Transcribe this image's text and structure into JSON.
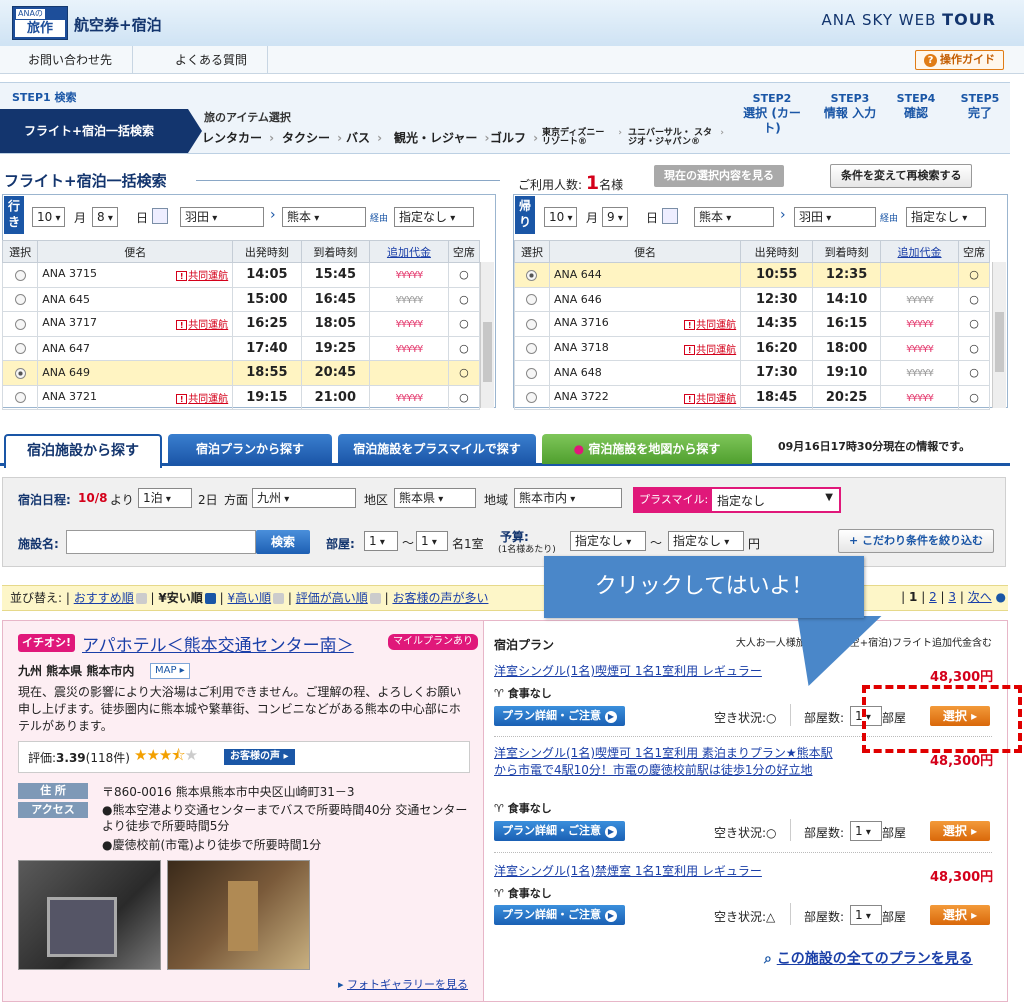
{
  "header": {
    "logo_top": "ANAの",
    "logo_main": "旅作",
    "title": "航空券+宿泊",
    "brand_prefix": "ANA SKY WEB",
    "brand_suffix": "TOUR"
  },
  "nav": {
    "items": [
      "お問い合わせ先",
      "よくある質問"
    ],
    "guide": "操作ガイド",
    "guide_icon": "?"
  },
  "steps": {
    "step1_label": "STEP1 検索",
    "step1_box": "フライト+宿泊一括検索",
    "items_heading": "旅のアイテム選択",
    "item_tabs": [
      "レンタカー",
      "タクシー",
      "バス",
      "観光・レジャー",
      "ゴルフ",
      "東京ディズニー リゾート®",
      "ユニバーサル・ スタジオ・ジャパン®"
    ],
    "later_steps": [
      {
        "num": "STEP2",
        "label": "選択 (カート)"
      },
      {
        "num": "STEP3",
        "label": "情報 入力"
      },
      {
        "num": "STEP4",
        "label": "確認"
      },
      {
        "num": "STEP5",
        "label": "完了"
      }
    ]
  },
  "search": {
    "heading": "フライト+宿泊一括検索",
    "pax_label": "ご利用人数:",
    "pax_count": "1",
    "pax_unit": "名様",
    "view_current": "現在の選択内容を見る",
    "re_search": "条件を変えて再検索する"
  },
  "outbound": {
    "dir": "行き",
    "month": "10",
    "month_unit": "月",
    "day": "8",
    "day_unit": "日",
    "from": "羽田",
    "to": "熊本",
    "via_label": "経由",
    "via": "指定なし",
    "headers": [
      "選択",
      "便名",
      "出発時刻",
      "到着時刻",
      "追加代金",
      "空席"
    ],
    "rows": [
      {
        "selected": false,
        "flight": "ANA 3715",
        "codeshare": true,
        "dep": "14:05",
        "arr": "15:45",
        "price": "¥¥¥¥¥",
        "grey": false,
        "seat": "○",
        "hl": false
      },
      {
        "selected": false,
        "flight": "ANA 645",
        "codeshare": false,
        "dep": "15:00",
        "arr": "16:45",
        "price": "¥¥¥¥¥",
        "grey": true,
        "seat": "○",
        "hl": false
      },
      {
        "selected": false,
        "flight": "ANA 3717",
        "codeshare": true,
        "dep": "16:25",
        "arr": "18:05",
        "price": "¥¥¥¥¥",
        "grey": false,
        "seat": "○",
        "hl": false
      },
      {
        "selected": false,
        "flight": "ANA 647",
        "codeshare": false,
        "dep": "17:40",
        "arr": "19:25",
        "price": "¥¥¥¥¥",
        "grey": false,
        "seat": "○",
        "hl": false
      },
      {
        "selected": true,
        "flight": "ANA 649",
        "codeshare": false,
        "dep": "18:55",
        "arr": "20:45",
        "price": "",
        "grey": false,
        "seat": "○",
        "hl": true
      },
      {
        "selected": false,
        "flight": "ANA 3721",
        "codeshare": true,
        "dep": "19:15",
        "arr": "21:00",
        "price": "¥¥¥¥¥",
        "grey": false,
        "seat": "○",
        "hl": false
      }
    ]
  },
  "inbound": {
    "dir": "帰り",
    "month": "10",
    "month_unit": "月",
    "day": "9",
    "day_unit": "日",
    "from": "熊本",
    "to": "羽田",
    "via_label": "経由",
    "via": "指定なし",
    "headers": [
      "選択",
      "便名",
      "出発時刻",
      "到着時刻",
      "追加代金",
      "空席"
    ],
    "rows": [
      {
        "selected": true,
        "flight": "ANA 644",
        "codeshare": false,
        "dep": "10:55",
        "arr": "12:35",
        "price": "",
        "grey": false,
        "seat": "○",
        "hl": true
      },
      {
        "selected": false,
        "flight": "ANA 646",
        "codeshare": false,
        "dep": "12:30",
        "arr": "14:10",
        "price": "¥¥¥¥¥",
        "grey": true,
        "seat": "○",
        "hl": false
      },
      {
        "selected": false,
        "flight": "ANA 3716",
        "codeshare": true,
        "dep": "14:35",
        "arr": "16:15",
        "price": "¥¥¥¥¥",
        "grey": false,
        "seat": "○",
        "hl": false
      },
      {
        "selected": false,
        "flight": "ANA 3718",
        "codeshare": true,
        "dep": "16:20",
        "arr": "18:00",
        "price": "¥¥¥¥¥",
        "grey": false,
        "seat": "○",
        "hl": false
      },
      {
        "selected": false,
        "flight": "ANA 648",
        "codeshare": false,
        "dep": "17:30",
        "arr": "19:10",
        "price": "¥¥¥¥¥",
        "grey": true,
        "seat": "○",
        "hl": false
      },
      {
        "selected": false,
        "flight": "ANA 3722",
        "codeshare": true,
        "dep": "18:45",
        "arr": "20:25",
        "price": "¥¥¥¥¥",
        "grey": false,
        "seat": "○",
        "hl": false
      }
    ]
  },
  "codeshare_label": "共同運航",
  "hotel_tabs": {
    "tabs": [
      "宿泊施設から探す",
      "宿泊プランから探す",
      "宿泊施設をプラスマイルで探す",
      "宿泊施設を地図から探す"
    ],
    "info": "09月16日17時30分現在の情報です。"
  },
  "hotel_search": {
    "date_label": "宿泊日程:",
    "date": "10/8",
    "date_from": "より",
    "nights": "1泊",
    "nights_suffix": "2日",
    "area_label": "方面",
    "area": "九州",
    "region_label": "地区",
    "region": "熊本県",
    "district_label": "地域",
    "district": "熊本市内",
    "plusmile_label": "プラスマイル:",
    "plusmile": "指定なし",
    "name_label": "施設名:",
    "name_value": "",
    "search_btn": "検索",
    "room_label": "部屋:",
    "room_from": "1",
    "room_to": "1",
    "room_unit": "名1室",
    "budget_label": "予算:",
    "budget_sub": "(1名様あたり)",
    "budget_from": "指定なし",
    "budget_to": "指定なし",
    "budget_unit": "円",
    "refine": "こだわり条件を絞り込む"
  },
  "sort": {
    "label": "並び替え:",
    "options": [
      "おすすめ順",
      "¥安い順",
      "¥高い順",
      "評価が高い順",
      "お客様の声が多い"
    ],
    "pages_sep": "|",
    "page_current": "1",
    "pages": [
      "2",
      "3"
    ],
    "next": "次へ"
  },
  "callout": "クリックしてはいよ！",
  "hotel": {
    "badge": "イチオシ!",
    "name": "アパホテル＜熊本交通センター南＞",
    "mile_badge": "マイルプランあり",
    "location": "九州 熊本県 熊本市内",
    "map_btn": "MAP ▸",
    "desc": "現在、震災の影響により大浴場はご利用できません。ご理解の程、よろしくお願い申し上げます。徒歩圏内に熊本城や繁華街、コンビニなどがある熊本の中心部にホテルがあります。",
    "rating_label": "評価:",
    "rating": "3.39",
    "reviews": "(118件)",
    "stars": 3.5,
    "voice_btn": "お客様の声 ▸",
    "address_tag": "住 所",
    "address": "〒860-0016 熊本県熊本市中央区山崎町31－3",
    "access_tag": "アクセス",
    "access": [
      "●熊本空港より交通センターまでバスで所要時間40分 交通センターより徒歩で所要時間5分",
      "●慶徳校前(市電)より徒歩で所要時間1分"
    ],
    "gallery": "フォトギャラリーを見る"
  },
  "plans": {
    "heading": "宿泊プラン",
    "note": "大人お一人様旅行代金(航空+宿泊)フライト追加代金含む",
    "avail_label": "空き状況:",
    "rooms_label": "部屋数:",
    "rooms_unit": "部屋",
    "detail_btn": "プラン詳細・ご注意",
    "select_btn": "選択 ▸",
    "items": [
      {
        "title": "洋室シングル(1名)喫煙可 1名1室利用 レギュラー",
        "price": "48,300円",
        "meal": "食事なし",
        "avail": "○",
        "rooms": "1"
      },
      {
        "title": "洋室シングル(1名)喫煙可 1名1室利用 素泊まりプラン★熊本駅から市電で4駅10分！市電の慶徳校前駅は徒歩1分の好立地",
        "price": "48,300円",
        "meal": "食事なし",
        "avail": "○",
        "rooms": "1"
      },
      {
        "title": "洋室シングル(1名)禁煙室 1名1室利用 レギュラー",
        "price": "48,300円",
        "meal": "食事なし",
        "avail": "△",
        "rooms": "1"
      }
    ],
    "all_plans": "この施設の全てのプランを見る"
  },
  "colors": {
    "navy": "#13356e",
    "accent": "#1a56a6",
    "pink": "#e0187a",
    "price_red": "#d4001a",
    "orange": "#e07c16",
    "callout": "#4a87c9",
    "dash": "#e00000"
  }
}
